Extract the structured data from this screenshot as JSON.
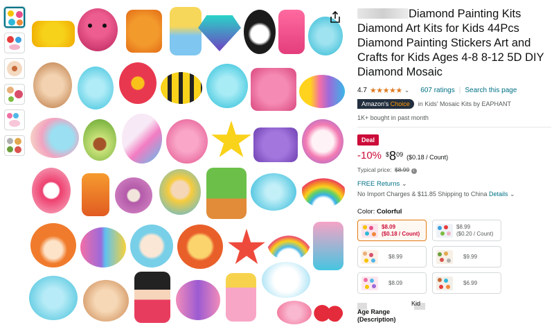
{
  "product": {
    "title": "Diamond Painting Kits Diamond Art Kits for Kids 44Pcs Diamond Painting Stickers Art and Crafts for Kids Ages 4-8 8-12 5D DIY Diamond Mosaic"
  },
  "rating": {
    "value": "4.7",
    "stars": "★★★★★",
    "chevron": "⌄",
    "count_text": "607 ratings",
    "search_link": "Search this page"
  },
  "badge": {
    "prefix": "Amazon's",
    "choice": "Choice",
    "context": "in Kids' Mosaic Kits by EAPHANT"
  },
  "bought": "1K+ bought in past month",
  "deal": {
    "label": "Deal",
    "discount": "-10%",
    "currency": "$",
    "whole": "8",
    "fraction": "09",
    "unit_price": "($0.18 / Count)",
    "typical_label": "Typical price:",
    "typical_price": "$8.99"
  },
  "delivery": {
    "free_returns": "FREE Returns",
    "shipping": "No Import Charges & $11.85 Shipping to China",
    "details": "Details"
  },
  "color": {
    "label": "Color:",
    "selected": "Colorful",
    "options": [
      {
        "price": "$8.09",
        "unit": "($0.18 / Count)",
        "selected": true
      },
      {
        "price": "$8.99",
        "unit": "($0.20 / Count)",
        "selected": false
      },
      {
        "price": "$8.99",
        "unit": "",
        "selected": false
      },
      {
        "price": "$9.99",
        "unit": "",
        "selected": false
      },
      {
        "price": "$8.09",
        "unit": "",
        "selected": false
      },
      {
        "price": "$6.99",
        "unit": "",
        "selected": false
      }
    ]
  },
  "attributes": {
    "age_key": "Age Range (Description)",
    "age_value": "Kid"
  },
  "icons": {
    "share": "share-icon",
    "info": "info-icon"
  },
  "colors": {
    "link": "#007185",
    "deal": "#cc0c39",
    "star": "#de7921",
    "selected_border": "#e47911"
  }
}
